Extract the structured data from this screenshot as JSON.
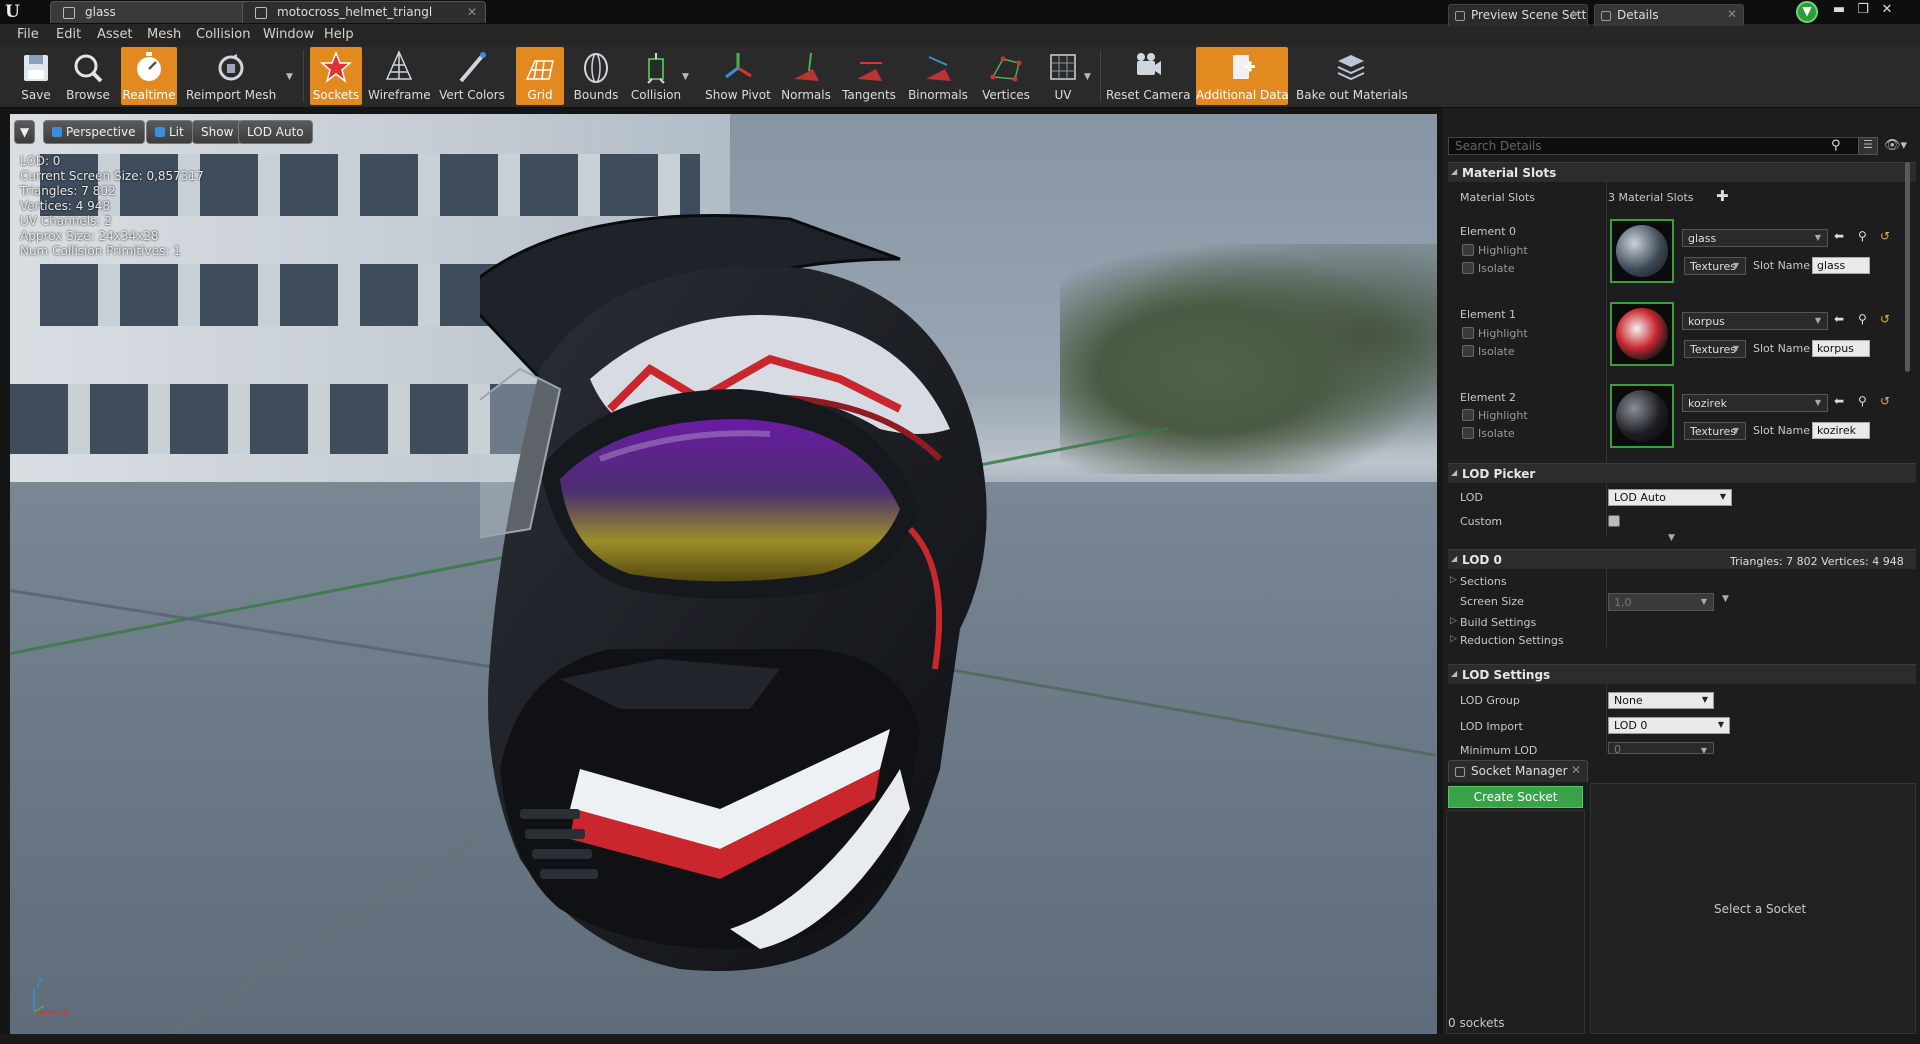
{
  "window": {
    "tabs": [
      {
        "label": "glass"
      },
      {
        "label": "motocross_helmet_triangl"
      }
    ],
    "controls": {
      "minimize": "▬",
      "restore": "❐",
      "close": "✕"
    }
  },
  "menu": [
    "File",
    "Edit",
    "Asset",
    "Mesh",
    "Collision",
    "Window",
    "Help"
  ],
  "toolbar": [
    {
      "label": "Save",
      "icon": "save-icon",
      "active": false
    },
    {
      "label": "Browse",
      "icon": "browse-icon",
      "active": false
    },
    {
      "label": "Realtime",
      "icon": "realtime-icon",
      "active": true
    },
    {
      "label": "Reimport Mesh",
      "icon": "reimport-icon",
      "active": false
    },
    {
      "label": "Sockets",
      "icon": "sockets-icon",
      "active": true
    },
    {
      "label": "Wireframe",
      "icon": "wireframe-icon",
      "active": false
    },
    {
      "label": "Vert Colors",
      "icon": "vert-colors-icon",
      "active": false
    },
    {
      "label": "Grid",
      "icon": "grid-icon",
      "active": true
    },
    {
      "label": "Bounds",
      "icon": "bounds-icon",
      "active": false
    },
    {
      "label": "Collision",
      "icon": "collision-icon",
      "active": false
    },
    {
      "label": "Show Pivot",
      "icon": "pivot-icon",
      "active": false
    },
    {
      "label": "Normals",
      "icon": "normals-icon",
      "active": false
    },
    {
      "label": "Tangents",
      "icon": "tangents-icon",
      "active": false
    },
    {
      "label": "Binormals",
      "icon": "binormals-icon",
      "active": false
    },
    {
      "label": "Vertices",
      "icon": "vertices-icon",
      "active": false
    },
    {
      "label": "UV",
      "icon": "uv-icon",
      "active": false
    },
    {
      "label": "Reset Camera",
      "icon": "reset-camera-icon",
      "active": false
    },
    {
      "label": "Additional Data",
      "icon": "additional-data-icon",
      "active": true
    },
    {
      "label": "Bake out Materials",
      "icon": "bake-materials-icon",
      "active": false
    }
  ],
  "viewport": {
    "buttons": {
      "perspective": "Perspective",
      "lit": "Lit",
      "show": "Show",
      "lod": "LOD Auto"
    },
    "stats": [
      "LOD:  0",
      "Current Screen Size:  0,857317",
      "Triangles:  7 802",
      "Vertices:  4 948",
      "UV Channels:  2",
      "Approx Size: 24x34x28",
      "Num Collision Primitives:  1"
    ],
    "axis": {
      "z": "Z",
      "x": "X"
    }
  },
  "details": {
    "tabs": [
      "Preview Scene Sett",
      "Details"
    ],
    "search_placeholder": "Search Details",
    "material_slots": {
      "header": "Material Slots",
      "label": "Material Slots",
      "count": "3 Material Slots",
      "elements": [
        {
          "label": "Element 0",
          "material": "glass",
          "slot_name": "glass",
          "highlight": "Highlight",
          "isolate": "Isolate",
          "textures": "Textures"
        },
        {
          "label": "Element 1",
          "material": "korpus",
          "slot_name": "korpus",
          "highlight": "Highlight",
          "isolate": "Isolate",
          "textures": "Textures"
        },
        {
          "label": "Element 2",
          "material": "kozirek",
          "slot_name": "kozirek",
          "highlight": "Highlight",
          "isolate": "Isolate",
          "textures": "Textures"
        }
      ],
      "slot_name_label": "Slot Name"
    },
    "lod_picker": {
      "header": "LOD Picker",
      "lod_label": "LOD",
      "lod_value": "LOD Auto",
      "custom_label": "Custom"
    },
    "lod0": {
      "header": "LOD 0",
      "stats": "Triangles: 7 802   Vertices: 4 948",
      "sections": "Sections",
      "screen_size_label": "Screen Size",
      "screen_size_value": "1,0",
      "build_settings": "Build Settings",
      "reduction_settings": "Reduction Settings"
    },
    "lod_settings": {
      "header": "LOD Settings",
      "group_label": "LOD Group",
      "group_value": "None",
      "import_label": "LOD Import",
      "import_value": "LOD 0",
      "min_lod_label": "Minimum LOD",
      "min_lod_value": "0"
    }
  },
  "socket_manager": {
    "tab": "Socket Manager",
    "create": "Create Socket",
    "count": "0 sockets",
    "empty": "Select a Socket"
  },
  "colors": {
    "accent": "#e28a1f",
    "green": "#3aa34a",
    "thumb_border": "#3c9f3c"
  }
}
